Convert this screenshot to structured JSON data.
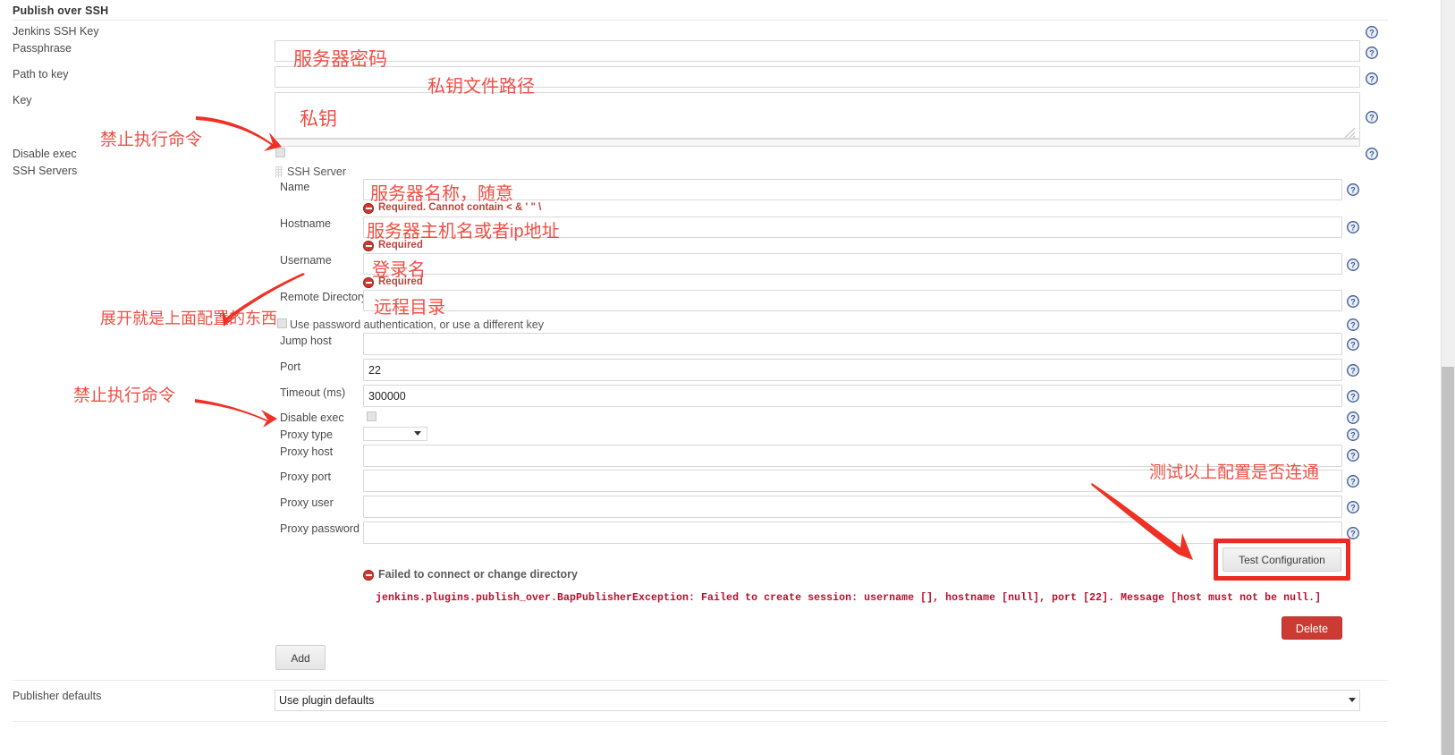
{
  "section": {
    "title": "Publish over SSH"
  },
  "global_fields": {
    "jenkins_ssh_key_label": "Jenkins SSH Key",
    "passphrase_label": "Passphrase",
    "passphrase_value": "",
    "path_to_key_label": "Path to key",
    "path_to_key_value": "",
    "key_label": "Key",
    "key_value": "",
    "disable_exec_label": "Disable exec",
    "disable_exec_checked": false,
    "ssh_servers_label": "SSH Servers"
  },
  "server": {
    "heading": "SSH Server",
    "name_label": "Name",
    "name_value": "",
    "name_error": "Required. Cannot contain < & ' \" \\",
    "hostname_label": "Hostname",
    "hostname_value": "",
    "hostname_error": "Required",
    "username_label": "Username",
    "username_value": "",
    "username_error": "Required",
    "remote_directory_label": "Remote Directory",
    "remote_directory_value": "",
    "use_password_label": "Use password authentication, or use a different key",
    "use_password_checked": false,
    "jump_host_label": "Jump host",
    "jump_host_value": "",
    "port_label": "Port",
    "port_value": "22",
    "timeout_label": "Timeout (ms)",
    "timeout_value": "300000",
    "disable_exec_label": "Disable exec",
    "disable_exec_checked": false,
    "proxy_type_label": "Proxy type",
    "proxy_type_value": "",
    "proxy_host_label": "Proxy host",
    "proxy_host_value": "",
    "proxy_port_label": "Proxy port",
    "proxy_port_value": "",
    "proxy_user_label": "Proxy user",
    "proxy_user_value": "",
    "proxy_password_label": "Proxy password",
    "proxy_password_value": ""
  },
  "test": {
    "button_label": "Test Configuration",
    "result_message": "Failed to connect or change directory",
    "stack_trace": "jenkins.plugins.publish_over.BapPublisherException: Failed to create session: username [], hostname [null], port [22]. Message [host must not be null.]"
  },
  "actions": {
    "delete_label": "Delete",
    "add_label": "Add"
  },
  "footer": {
    "publisher_defaults_label": "Publisher defaults",
    "publisher_defaults_value": "Use plugin defaults"
  },
  "annotations": [
    {
      "text": "服务器密码",
      "note": "server password"
    },
    {
      "text": "私钥文件路径",
      "note": "private key file path"
    },
    {
      "text": "私钥",
      "note": "private key"
    },
    {
      "text": "禁止执行命令",
      "note": "disable exec"
    },
    {
      "text": "服务器名称，随意",
      "note": "server name, arbitrary"
    },
    {
      "text": "服务器主机名或者ip地址",
      "note": "server hostname or ip address"
    },
    {
      "text": "登录名",
      "note": "login name"
    },
    {
      "text": "远程目录",
      "note": "remote directory"
    },
    {
      "text": "展开就是上面配置的东西",
      "note": "expand to show the config above"
    },
    {
      "text": "禁止执行命令",
      "note": "disable exec"
    },
    {
      "text": "测试以上配置是否连通",
      "note": "test whether the above config connects"
    }
  ],
  "icons": {
    "help": "help-question-icon",
    "grip": "drag-handle-icon",
    "caret": "chevron-down-icon"
  },
  "colors": {
    "annotation_red": "#ef4136",
    "highlight_red": "#ee2a24",
    "error_red": "#cc3b33",
    "trace_red": "#bb0d2c",
    "help_blue": "#3b5998"
  },
  "scrollbar": {
    "orientation": "vertical"
  }
}
